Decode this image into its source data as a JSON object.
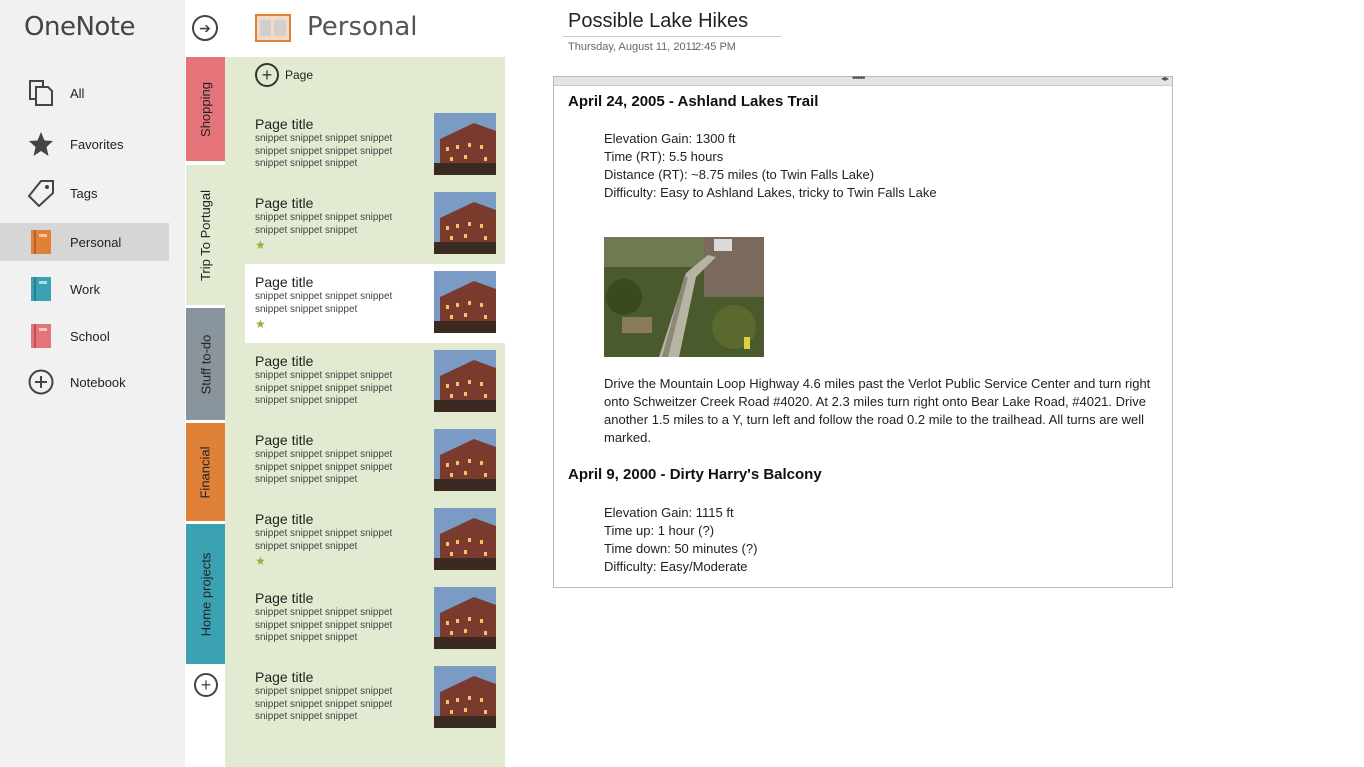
{
  "app": {
    "title": "OneNote"
  },
  "nav": {
    "items": [
      {
        "label": "All",
        "icon": "all-pages-icon"
      },
      {
        "label": "Favorites",
        "icon": "star-icon"
      },
      {
        "label": "Tags",
        "icon": "tag-icon"
      },
      {
        "label": "Personal",
        "icon": "notebook-icon",
        "color": "#e0813a",
        "selected": true
      },
      {
        "label": "Work",
        "icon": "notebook-icon",
        "color": "#3aa2b3"
      },
      {
        "label": "School",
        "icon": "notebook-icon",
        "color": "#e4737a"
      },
      {
        "label": "Notebook",
        "icon": "add-circle-icon"
      }
    ]
  },
  "sections": [
    {
      "label": "Shopping",
      "color": "#e4737a"
    },
    {
      "label": "Trip To Portugal",
      "color": "#e2ebd2"
    },
    {
      "label": "Stuff to-do",
      "color": "#8a949c"
    },
    {
      "label": "Financial",
      "color": "#e0813a"
    },
    {
      "label": "Home projects",
      "color": "#3aa2b3"
    }
  ],
  "pagelist": {
    "section_title": "Personal",
    "add_page_label": "Page",
    "pages": [
      {
        "title": "Page title",
        "snippet": "snippet snippet snippet snippet snippet snippet snippet snippet snippet snippet snippet",
        "favorite": false
      },
      {
        "title": "Page title",
        "snippet": "snippet snippet snippet snippet snippet snippet snippet",
        "favorite": true
      },
      {
        "title": "Page title",
        "snippet": "snippet snippet snippet snippet snippet snippet snippet",
        "favorite": true,
        "selected": true
      },
      {
        "title": "Page title",
        "snippet": "snippet snippet snippet snippet snippet snippet snippet snippet snippet snippet snippet",
        "favorite": false
      },
      {
        "title": "Page title",
        "snippet": "snippet snippet snippet snippet snippet snippet snippet snippet snippet snippet snippet",
        "favorite": false
      },
      {
        "title": "Page title",
        "snippet": "snippet snippet snippet snippet snippet snippet snippet",
        "favorite": true
      },
      {
        "title": "Page title",
        "snippet": "snippet snippet snippet snippet snippet snippet snippet snippet snippet snippet snippet",
        "favorite": false
      },
      {
        "title": "Page title",
        "snippet": "snippet snippet snippet snippet snippet snippet snippet snippet snippet snippet snippet",
        "favorite": false
      }
    ]
  },
  "page": {
    "title": "Possible Lake Hikes",
    "date": "Thursday, August 11, 2011",
    "time": "2:45 PM",
    "hike1": {
      "heading": "April 24, 2005 - Ashland Lakes Trail",
      "elevation": "Elevation Gain: 1300 ft",
      "time": "Time (RT): 5.5 hours",
      "distance": "Distance (RT): ~8.75 miles (to Twin Falls Lake)",
      "difficulty": "Difficulty: Easy to Ashland Lakes, tricky to Twin Falls Lake",
      "directions": "Drive the Mountain Loop Highway 4.6 miles past the Verlot Public Service Center and turn right onto Schweitzer Creek Road #4020. At 2.3 miles turn right onto Bear Lake Road, #4021. Drive another 1.5 miles to a Y, turn left and follow the road 0.2 mile to the trailhead. All turns are well marked."
    },
    "hike2": {
      "heading": "April 9, 2000 - Dirty Harry's Balcony",
      "elevation": "Elevation Gain: 1115 ft",
      "time_up": "Time up: 1 hour (?)",
      "time_down": "Time down: 50 minutes (?)",
      "difficulty": "Difficulty: Easy/Moderate"
    }
  }
}
